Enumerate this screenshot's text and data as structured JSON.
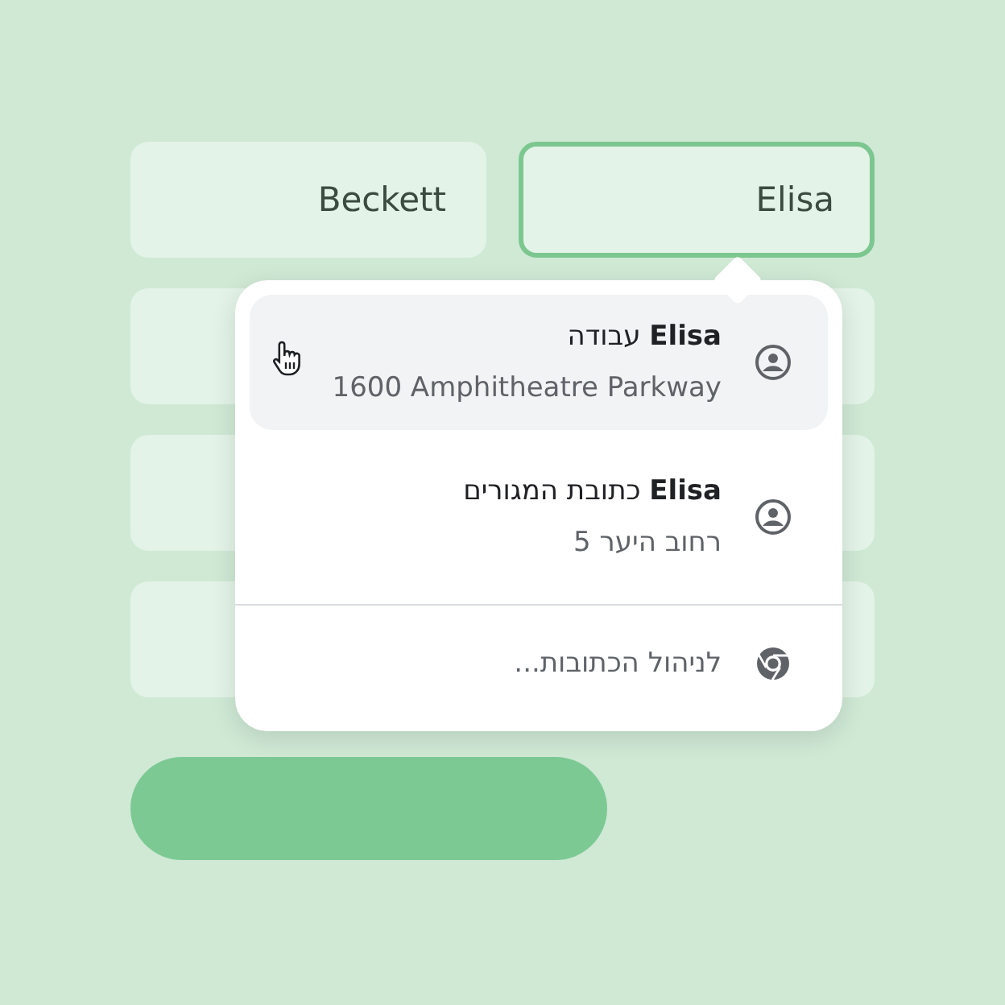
{
  "form": {
    "fields": [
      {
        "value": "Elisa",
        "focused": true
      },
      {
        "value": "Beckett",
        "focused": false
      },
      {
        "focused": false
      },
      {
        "focused": false
      },
      {
        "focused": false
      },
      {
        "focused": false
      },
      {
        "focused": false
      },
      {
        "focused": false
      }
    ]
  },
  "autofill": {
    "items": [
      {
        "kind": "address",
        "title": "**Elisa** עבודה",
        "subtitle": "1600 Amphitheatre Parkway",
        "selected": true
      },
      {
        "kind": "address",
        "title": "**Elisa** כתובת המגורים",
        "subtitle": "רחוב היער 5",
        "selected": false
      },
      {
        "kind": "manage",
        "title": "לניהול הכתובות..."
      }
    ]
  }
}
